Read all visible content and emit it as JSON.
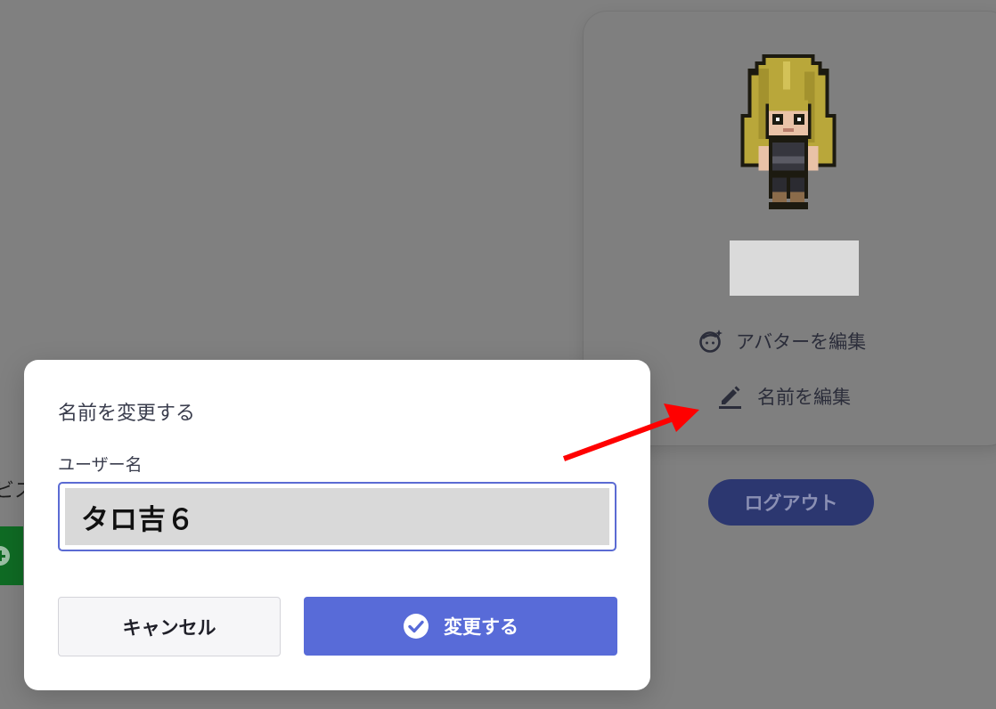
{
  "background": {
    "partial_text": "ビス",
    "profile_card": {
      "edit_avatar_label": "アバターを編集",
      "edit_name_label": "名前を編集",
      "logout_label": "ログアウト"
    }
  },
  "modal": {
    "title": "名前を変更する",
    "field_label": "ユーザー名",
    "field_value": "タロ吉６",
    "cancel_label": "キャンセル",
    "confirm_label": "変更する"
  },
  "colors": {
    "overlay": "#808080",
    "accent": "#586bd8",
    "input_border": "#5b6bd3",
    "arrow": "#ff0000",
    "logout_bg": "#2c3770"
  },
  "icons": {
    "edit_avatar": "face-sparkle-icon",
    "edit_name": "pencil-icon",
    "confirm": "check-circle-icon",
    "add": "plus-circle-icon"
  }
}
